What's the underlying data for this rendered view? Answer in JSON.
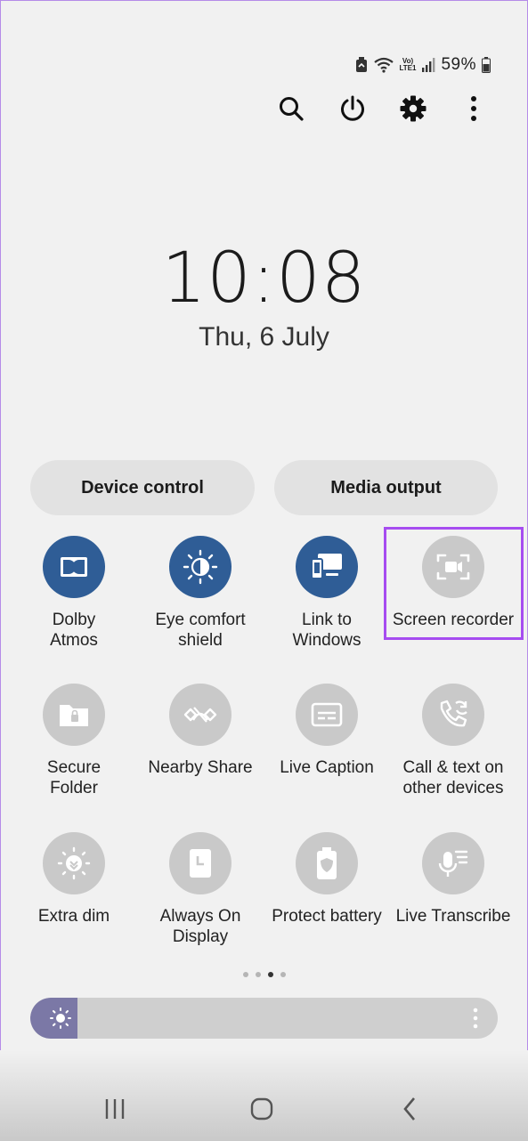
{
  "status_bar": {
    "battery_percent": "59%",
    "network_label_top": "Vo)",
    "network_label_bottom": "LTE1"
  },
  "header_icons": [
    "search-icon",
    "power-icon",
    "settings-icon",
    "more-icon"
  ],
  "clock": {
    "time": "10:08",
    "date": "Thu, 6 July"
  },
  "quick_buttons": {
    "device_control": "Device control",
    "media_output": "Media output"
  },
  "tiles": [
    {
      "line1": "Dolby",
      "line2": "Atmos",
      "active": true,
      "icon": "dolby-icon"
    },
    {
      "line1": "Eye comfort",
      "line2": "shield",
      "active": true,
      "icon": "eye-comfort-icon"
    },
    {
      "line1": "Link to",
      "line2": "Windows",
      "active": true,
      "icon": "link-windows-icon"
    },
    {
      "line1": "Screen recorder",
      "line2": "",
      "active": false,
      "icon": "screen-recorder-icon"
    },
    {
      "line1": "Secure",
      "line2": "Folder",
      "active": false,
      "icon": "folder-icon"
    },
    {
      "line1": "Nearby Share",
      "line2": "",
      "active": false,
      "icon": "nearby-share-icon"
    },
    {
      "line1": "Live Caption",
      "line2": "",
      "active": false,
      "icon": "caption-icon"
    },
    {
      "line1": "Call & text on",
      "line2": "other devices",
      "active": false,
      "icon": "call-text-icon"
    },
    {
      "line1": "Extra dim",
      "line2": "",
      "active": false,
      "icon": "extra-dim-icon"
    },
    {
      "line1": "Always On",
      "line2": "Display",
      "active": false,
      "icon": "always-on-icon"
    },
    {
      "line1": "Protect battery",
      "line2": "",
      "active": false,
      "icon": "protect-battery-icon"
    },
    {
      "line1": "Live Transcribe",
      "line2": "",
      "active": false,
      "icon": "transcribe-icon"
    }
  ],
  "page_indicator": {
    "pages": 4,
    "current": 3
  },
  "brightness": {
    "level": 0.1
  },
  "colors": {
    "active_tile": "#2f5d96",
    "inactive_tile": "#c9c9c9",
    "highlight": "#a64cf0",
    "brightness_fill": "#7b78a6"
  },
  "nav_icons": [
    "recents-icon",
    "home-icon",
    "back-icon"
  ]
}
